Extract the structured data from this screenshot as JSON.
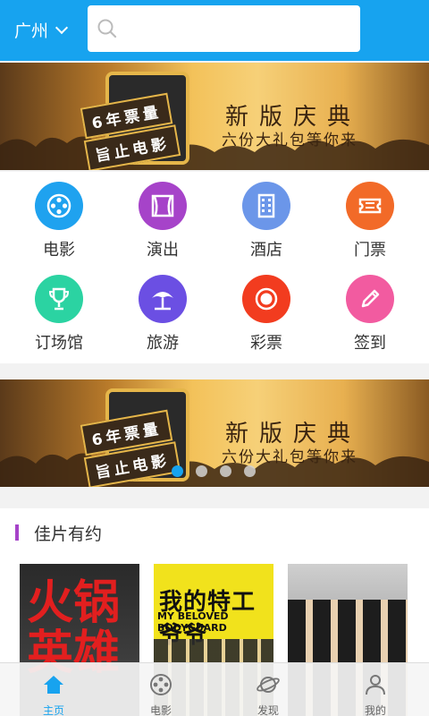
{
  "header": {
    "city": "广州",
    "search_placeholder": ""
  },
  "banner": {
    "tag_line1": "6年票量",
    "tag_line2": "旨止电影",
    "title": "新版庆典",
    "subtitle": "六份大礼包等你来"
  },
  "categories": [
    {
      "label": "电影",
      "icon": "film-reel-icon",
      "color": "#1fa2ef"
    },
    {
      "label": "演出",
      "icon": "stage-curtain-icon",
      "color": "#a643c9"
    },
    {
      "label": "酒店",
      "icon": "hotel-building-icon",
      "color": "#6b96e9"
    },
    {
      "label": "门票",
      "icon": "ticket-icon",
      "color": "#f26a28"
    },
    {
      "label": "订场馆",
      "icon": "trophy-icon",
      "color": "#2bd3a2"
    },
    {
      "label": "旅游",
      "icon": "beach-umbrella-icon",
      "color": "#6b4fe3"
    },
    {
      "label": "彩票",
      "icon": "lottery-ball-icon",
      "color": "#f23c1f"
    },
    {
      "label": "签到",
      "icon": "pencil-icon",
      "color": "#f25ba0"
    }
  ],
  "carousel": {
    "pages": 4,
    "active": 0
  },
  "section": {
    "title": "佳片有约"
  },
  "posters": [
    {
      "text": "火锅英雄",
      "style": "red-title-on-dark"
    },
    {
      "text": "我的特工爷爷",
      "english": "MY BELOVED BODYGUARD"
    },
    {
      "text": "",
      "style": "group-photo"
    }
  ],
  "tabs": [
    {
      "label": "主页",
      "icon": "home-icon"
    },
    {
      "label": "电影",
      "icon": "film-reel-icon"
    },
    {
      "label": "发现",
      "icon": "planet-icon"
    },
    {
      "label": "我的",
      "icon": "user-icon"
    }
  ],
  "colors": {
    "primary": "#17a3ef"
  }
}
